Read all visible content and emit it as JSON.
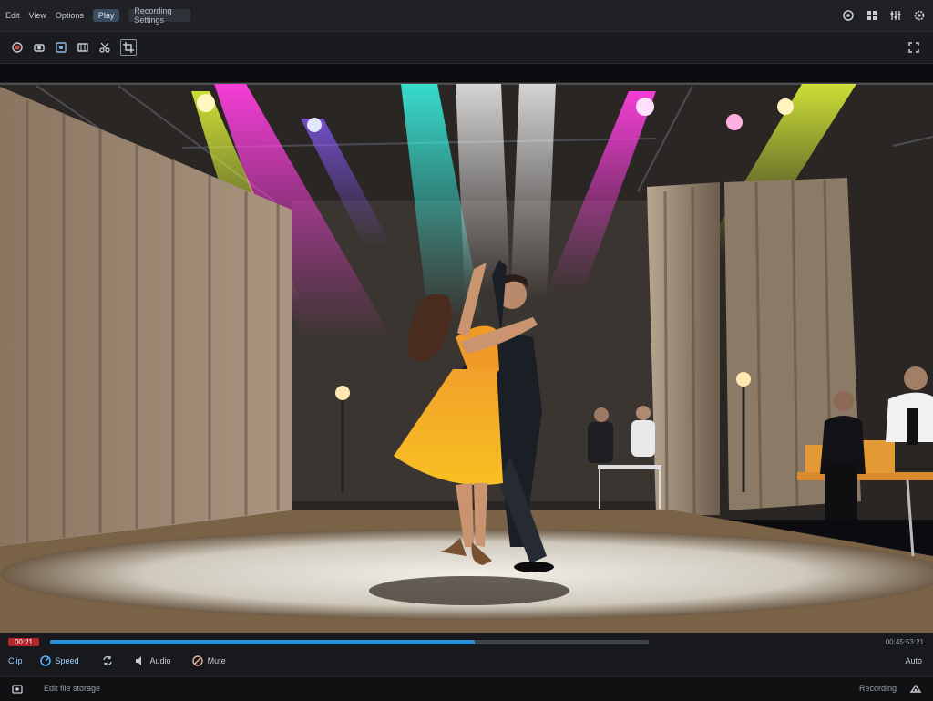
{
  "window": {
    "tabs": [
      {
        "label": "Edit"
      },
      {
        "label": "View"
      },
      {
        "label": "Options"
      },
      {
        "label": "Play"
      },
      {
        "label": "Recording Settings"
      }
    ],
    "title_bar_icons": [
      "settings-icon",
      "grid-icon",
      "sliders-icon",
      "gear-icon"
    ]
  },
  "toolbar": {
    "icons": [
      "record-icon",
      "camera-icon",
      "screenshot-icon",
      "film-icon",
      "scissors-icon",
      "crop-icon"
    ],
    "right_icon": "fullscreen-icon"
  },
  "player": {
    "current_time_label": "00:21",
    "progress_fraction": 0.71,
    "right_readout": "00:45:53:21",
    "controls": [
      {
        "label": "Clip"
      },
      {
        "label": "Speed"
      },
      {
        "label": "Loop"
      },
      {
        "label": "Audio"
      },
      {
        "label": "Mute"
      }
    ],
    "quality_label": "Auto"
  },
  "status": {
    "left_text": "Edit file storage",
    "right_text": "Recording"
  },
  "colors": {
    "accent": "#2d8fd6",
    "record": "#b3262a"
  }
}
